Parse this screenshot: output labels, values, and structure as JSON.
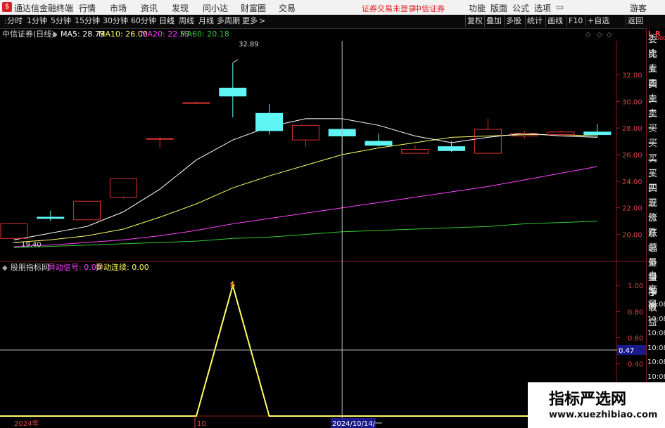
{
  "app": {
    "name": "通达信金融终端",
    "menus": [
      "行情",
      "市场",
      "资讯",
      "发现",
      "问小达",
      "财富圈",
      "交易"
    ],
    "warn": "证券交易未登录",
    "broker": "中信证券",
    "right_menus": [
      "功能",
      "版面",
      "公式",
      "选项"
    ],
    "user": "游客"
  },
  "toolbar": {
    "periods": [
      "分时",
      "1分钟",
      "5分钟",
      "15分钟",
      "30分钟",
      "60分钟",
      "日线",
      "周线",
      "月线",
      "多周期",
      "更多"
    ],
    "active_period": "日线",
    "more_arrow": ">",
    "right_buttons": [
      "复权",
      "叠加",
      "多股",
      "统计",
      "画线",
      "F10",
      "+自选",
      "返回"
    ]
  },
  "main_panel": {
    "title": "中信证券(日线)",
    "ma5_label": "MA5: 28.73",
    "ma10_label": "MA10: 26.00",
    "ma20_label": "MA20: 22.53",
    "ma60_label": "MA60: 20.18",
    "high_label": "32.89",
    "low_label": "19.40",
    "ma5_color": "#ffffff",
    "ma10_color": "#ffff66",
    "ma20_color": "#ff44ff",
    "ma60_color": "#33cc33"
  },
  "sub_panel": {
    "title": "股朋指标网",
    "sig_label": "异动信号: 0.00",
    "cont_label": "异动连续: 0.00",
    "cursor_value": "0.47",
    "marker": "$"
  },
  "x_axis": {
    "labels": [
      "2024年",
      "10",
      "2024/10/14/一"
    ]
  },
  "sidebar": {
    "lr": "L R",
    "top_small": "500",
    "items": [
      "委比",
      "卖五",
      "卖四",
      "卖三",
      "卖二",
      "卖一",
      "买一",
      "买二",
      "买三",
      "买四",
      "买五",
      "现价",
      "涨跌",
      "涨幅",
      "总量",
      "外盘",
      "换手",
      "净资",
      "收益",
      "自动",
      "交易",
      "10:08",
      "10:08",
      "10:08",
      "10:08",
      "10:08",
      "10:08",
      "10:08",
      "10:08"
    ]
  },
  "watermark": {
    "title": "指标严选网",
    "url": "www.xuezhibiao.com"
  },
  "chart_data": {
    "type": "candlestick",
    "ylim": [
      18.5,
      33.5
    ],
    "yticks": [
      "32.00",
      "30.00",
      "28.00",
      "26.00",
      "24.00",
      "22.00",
      "20.00"
    ],
    "candles": [
      {
        "o": 19.7,
        "h": 20.8,
        "l": 19.6,
        "c": 20.8
      },
      {
        "o": 21.3,
        "h": 21.8,
        "l": 21.0,
        "c": 21.2
      },
      {
        "o": 21.1,
        "h": 22.5,
        "l": 21.1,
        "c": 22.5
      },
      {
        "o": 22.8,
        "h": 24.2,
        "l": 22.7,
        "c": 24.2
      },
      {
        "o": 27.2,
        "h": 27.3,
        "l": 26.5,
        "c": 27.2
      },
      {
        "o": 29.9,
        "h": 30.0,
        "l": 29.9,
        "c": 29.9
      },
      {
        "o": 31.0,
        "h": 32.9,
        "l": 28.8,
        "c": 30.4
      },
      {
        "o": 29.1,
        "h": 29.8,
        "l": 27.5,
        "c": 27.8
      },
      {
        "o": 27.1,
        "h": 28.2,
        "l": 26.6,
        "c": 28.2
      },
      {
        "o": 27.9,
        "h": 28.0,
        "l": 26.0,
        "c": 27.4
      },
      {
        "o": 27.0,
        "h": 27.6,
        "l": 26.6,
        "c": 26.7
      },
      {
        "o": 26.1,
        "h": 26.7,
        "l": 26.1,
        "c": 26.4
      },
      {
        "o": 26.6,
        "h": 27.0,
        "l": 26.2,
        "c": 26.3
      },
      {
        "o": 26.1,
        "h": 28.7,
        "l": 26.1,
        "c": 27.9
      },
      {
        "o": 27.4,
        "h": 27.8,
        "l": 27.2,
        "c": 27.6
      },
      {
        "o": 27.5,
        "h": 27.8,
        "l": 27.4,
        "c": 27.7
      },
      {
        "o": 27.7,
        "h": 28.3,
        "l": 27.3,
        "c": 27.5
      }
    ],
    "ma5": [
      19.6,
      20.1,
      20.6,
      21.7,
      23.4,
      25.6,
      27.1,
      28.1,
      28.7,
      28.7,
      28.2,
      27.4,
      26.9,
      27.3,
      27.6,
      27.4,
      27.3
    ],
    "ma10": [
      19.4,
      19.6,
      19.9,
      20.4,
      21.3,
      22.3,
      23.5,
      24.4,
      25.2,
      26.0,
      26.5,
      26.9,
      27.3,
      27.4,
      27.5,
      27.5,
      27.4
    ],
    "ma20": [
      19.1,
      19.2,
      19.4,
      19.6,
      19.9,
      20.3,
      20.8,
      21.2,
      21.6,
      22.0,
      22.4,
      22.8,
      23.2,
      23.6,
      24.1,
      24.6,
      25.1
    ],
    "ma60": [
      19.0,
      19.1,
      19.2,
      19.3,
      19.4,
      19.5,
      19.7,
      19.8,
      20.0,
      20.2,
      20.3,
      20.4,
      20.5,
      20.6,
      20.8,
      20.9,
      21.0
    ],
    "sub_ylim": [
      0.0,
      1.06
    ],
    "sub_yticks": [
      "1.00",
      "0.80",
      "0.60",
      "0.40"
    ],
    "signal": [
      0,
      0,
      0,
      0,
      0,
      0,
      1.0,
      0,
      0,
      0,
      0,
      0,
      0,
      0,
      0,
      0,
      0
    ],
    "cursor_index": 9
  }
}
